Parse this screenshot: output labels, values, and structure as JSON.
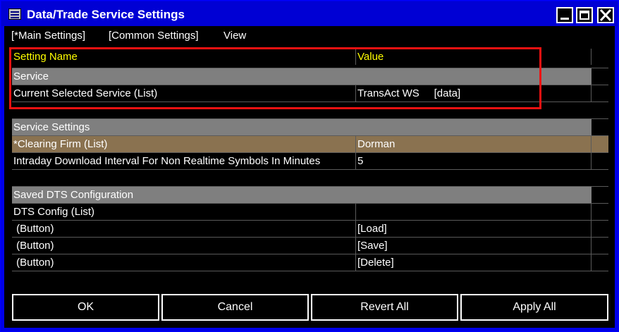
{
  "window": {
    "title": "Data/Trade Service Settings"
  },
  "menu": {
    "items": [
      "[*Main Settings]",
      "[Common Settings]",
      "View"
    ]
  },
  "grid": {
    "headers": {
      "name": "Setting Name",
      "value": "Value"
    },
    "groups": {
      "service": "Service",
      "service_settings": "Service Settings",
      "saved_dts": "Saved DTS Configuration"
    },
    "rows": {
      "current_service": {
        "name": "Current Selected Service (List)",
        "value": "TransAct WS     [data]"
      },
      "clearing_firm": {
        "name": "*Clearing Firm (List)",
        "value": "Dorman"
      },
      "intraday_interval": {
        "name": "Intraday Download Interval For Non Realtime Symbols In Minutes",
        "value": "5"
      },
      "dts_config": {
        "name": "DTS Config (List)",
        "value": ""
      },
      "load": {
        "name": " (Button)",
        "value": "[Load]"
      },
      "save": {
        "name": " (Button)",
        "value": "[Save]"
      },
      "delete": {
        "name": " (Button)",
        "value": "[Delete]"
      }
    }
  },
  "buttons": {
    "ok": "OK",
    "cancel": "Cancel",
    "revert_all": "Revert All",
    "apply_all": "Apply All"
  },
  "colors": {
    "highlight": "#ee1111",
    "header_text": "#ffff00",
    "group_bg": "#7f7f7f",
    "selected_bg": "#8a7250",
    "titlebar": "#0000d4"
  }
}
